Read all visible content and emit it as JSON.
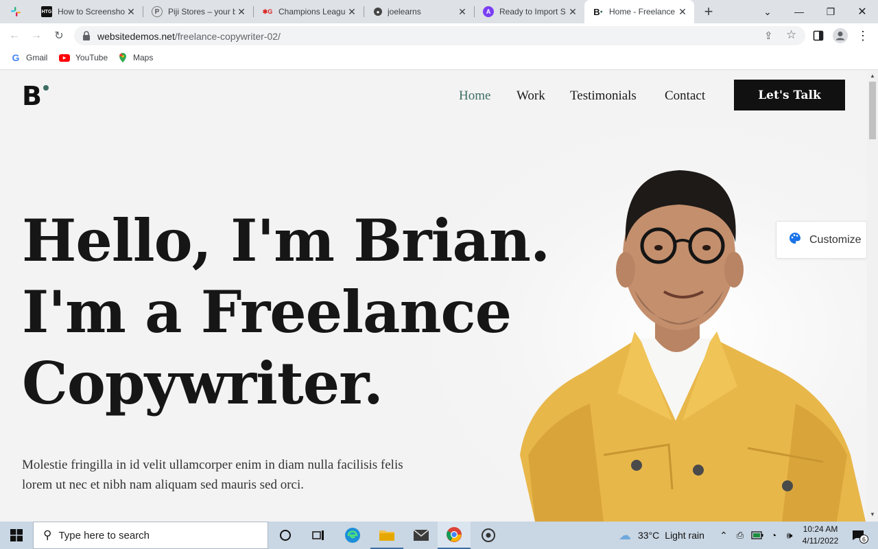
{
  "tabs": [
    {
      "title": "How to Screenshot",
      "favicon": "htg-icon"
    },
    {
      "title": "Piji Stores – your b",
      "favicon": "piji-icon"
    },
    {
      "title": "Champions League",
      "favicon": "uefa-icon"
    },
    {
      "title": "joelearns",
      "favicon": "globe-icon"
    },
    {
      "title": "Ready to Import S",
      "favicon": "astra-icon"
    },
    {
      "title": "Home - Freelance",
      "favicon": "brian-icon"
    }
  ],
  "address": {
    "domain": "websitedemos.net",
    "path": "/freelance-copywriter-02/"
  },
  "bookmarks": [
    {
      "label": "Gmail"
    },
    {
      "label": "YouTube"
    },
    {
      "label": "Maps"
    }
  ],
  "site": {
    "logo": "B",
    "nav": [
      "Home",
      "Work",
      "Testimonials",
      "Contact"
    ],
    "cta": "Let's Talk",
    "hero_lines": [
      "Hello, I'm Brian.",
      "I'm a Freelance",
      "Copywriter."
    ],
    "hero_paragraph": "Molestie fringilla in id velit ullamcorper enim in diam nulla facilisis felis lorem ut nec et nibh nam aliquam sed mauris sed orci.",
    "customize_label": "Customize",
    "accent": "#3d6e63"
  },
  "taskbar": {
    "search_placeholder": "Type here to search",
    "weather_temp": "33°C",
    "weather_text": "Light rain",
    "time": "10:24 AM",
    "date": "4/11/2022",
    "notifications": "6"
  }
}
